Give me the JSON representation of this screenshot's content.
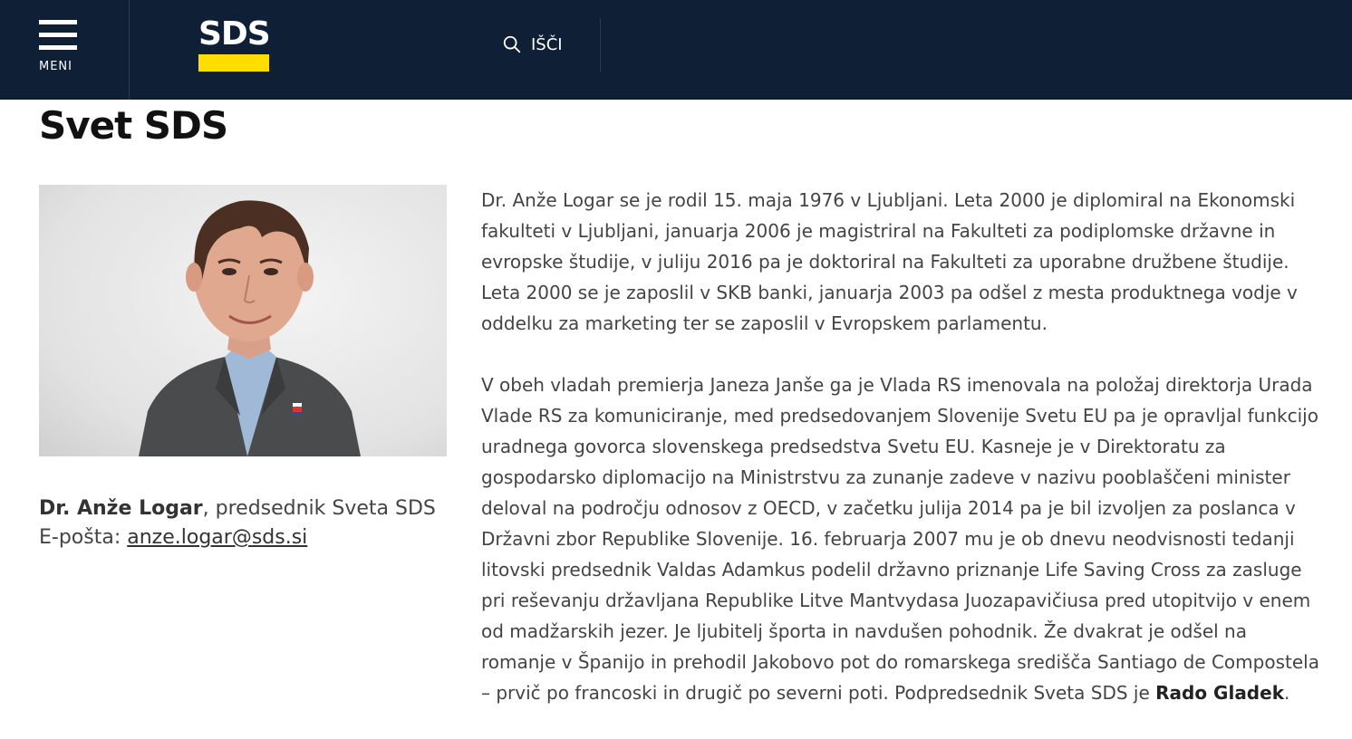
{
  "header": {
    "menu_label": "MENI",
    "logo_text": "SDS",
    "search_label": "IŠČI",
    "colors": {
      "background": "#0e1f36",
      "logo_accent": "#ffdd00"
    }
  },
  "page": {
    "title": "Svet SDS"
  },
  "profile": {
    "name": "Dr. Anže Logar",
    "role": ", predsednik Sveta SDS",
    "email_label": "E-pošta: ",
    "email": "anze.logar@sds.si"
  },
  "bio": {
    "paragraph1": "Dr. Anže Logar se je rodil 15. maja 1976 v Ljubljani. Leta 2000 je diplomiral na Ekonomski fakulteti v Ljubljani, januarja 2006 je magistriral na Fakulteti za podiplomske državne in evropske študije, v juliju 2016 pa je doktoriral na Fakulteti za uporabne družbene študije. Leta 2000 se je zaposlil v SKB banki, januarja 2003 pa odšel z mesta produktnega vodje v oddelku za marketing ter se zaposlil v Evropskem parlamentu.",
    "paragraph2": "V obeh vladah premierja Janeza Janše ga je Vlada RS imenovala na položaj direktorja Urada Vlade RS za komuniciranje, med predsedovanjem Slovenije Svetu EU pa je opravljal funkcijo uradnega govorca slovenskega predsedstva Svetu EU. Kasneje je v Direktoratu za gospodarsko diplomacijo na Ministrstvu za zunanje zadeve v nazivu pooblaščeni minister deloval na področju odnosov z OECD, v začetku julija 2014 pa je bil izvoljen za poslanca v Državni zbor Republike Slovenije. 16. februarja 2007 mu je ob dnevu neodvisnosti tedanji litovski predsednik Valdas Adamkus podelil državno priznanje Life Saving Cross za zasluge pri reševanju državljana Republike Litve Mantvydasa Juozapavičiusa pred utopitvijo v enem od madžarskih jezer. Je ljubitelj športa in navdušen pohodnik. Že dvakrat je odšel na romanje v Španijo in prehodil Jakobovo pot do romarskega središča Santiago de Compostela – prvič po francoski in drugič po severni poti. Podpredsednik Sveta SDS je ",
    "vice_president": "Rado Gladek",
    "end": "."
  },
  "icons": {
    "menu": "hamburger-icon",
    "search": "search-icon"
  }
}
